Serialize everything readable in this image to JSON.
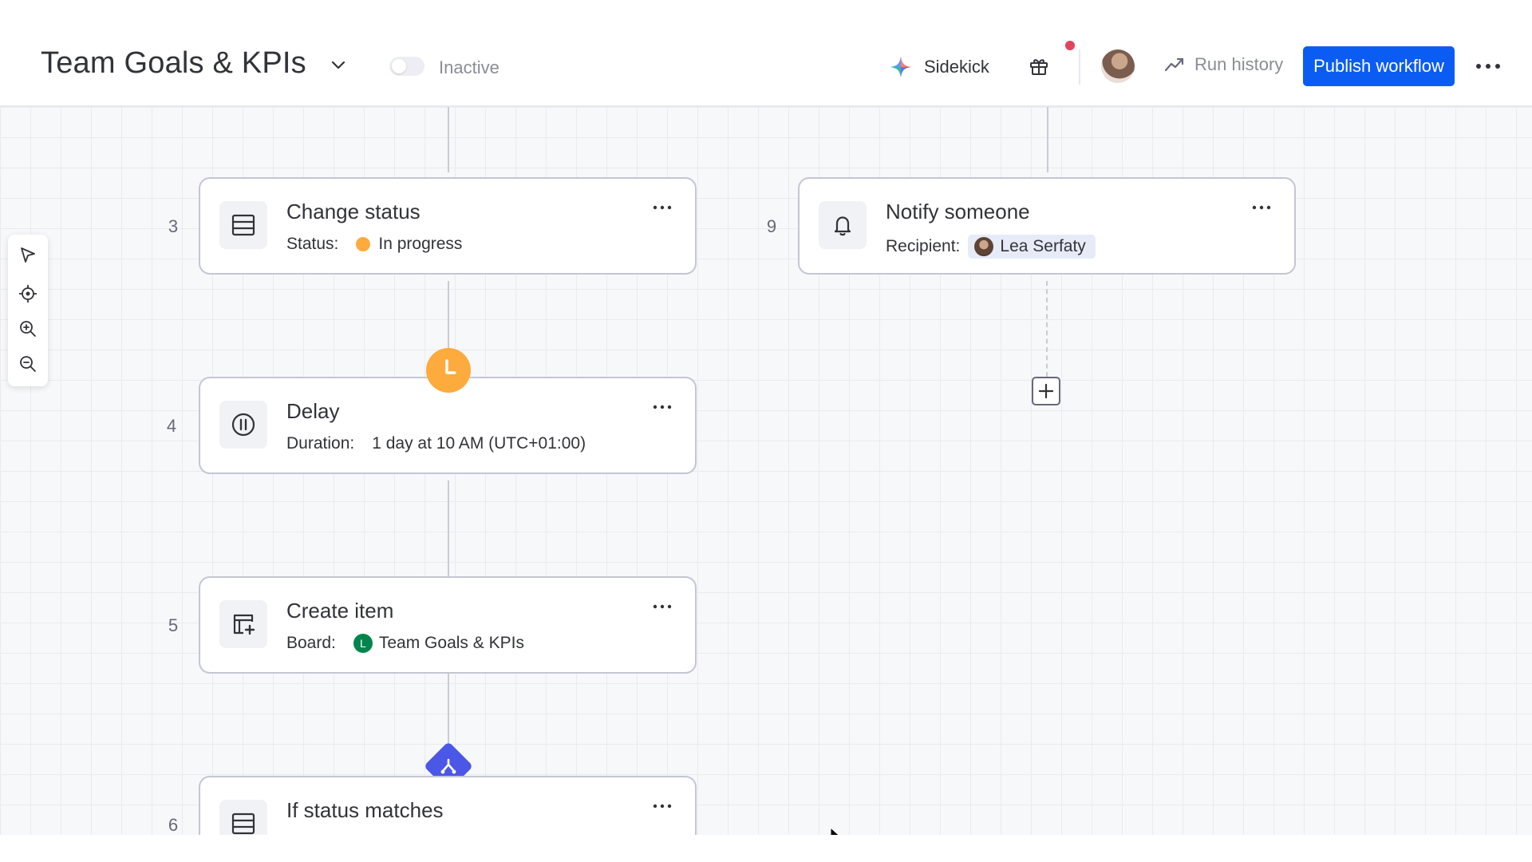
{
  "header": {
    "title": "Team Goals & KPIs",
    "status_label": "Inactive",
    "sidekick_label": "Sidekick",
    "run_history_label": "Run history",
    "publish_label": "Publish workflow"
  },
  "colors": {
    "accent": "#0b5cf3",
    "status_in_progress": "#fdab3d",
    "delay_badge": "#fdab3d",
    "condition_diamond": "#4b57e7",
    "board_badge": "#00854d",
    "notification_dot": "#e2445c"
  },
  "toolbar": {
    "tools": [
      "select-pointer-icon",
      "recenter-icon",
      "zoom-in-icon",
      "zoom-out-icon"
    ]
  },
  "steps": {
    "change_status": {
      "number": "3",
      "title": "Change status",
      "field_label": "Status:",
      "field_value": "In progress",
      "icon": "table-icon"
    },
    "delay": {
      "number": "4",
      "title": "Delay",
      "field_label": "Duration:",
      "field_value": "1 day at 10 AM (UTC+01:00)",
      "icon": "pause-icon"
    },
    "create_item": {
      "number": "5",
      "title": "Create item",
      "field_label": "Board:",
      "field_value": "Team Goals & KPIs",
      "board_initial": "L",
      "icon": "create-item-icon"
    },
    "if_status": {
      "number": "6",
      "title": "If status matches",
      "icon": "table-icon"
    },
    "notify": {
      "number": "9",
      "title": "Notify someone",
      "field_label": "Recipient:",
      "field_value": "Lea Serfaty",
      "icon": "bell-icon"
    }
  }
}
